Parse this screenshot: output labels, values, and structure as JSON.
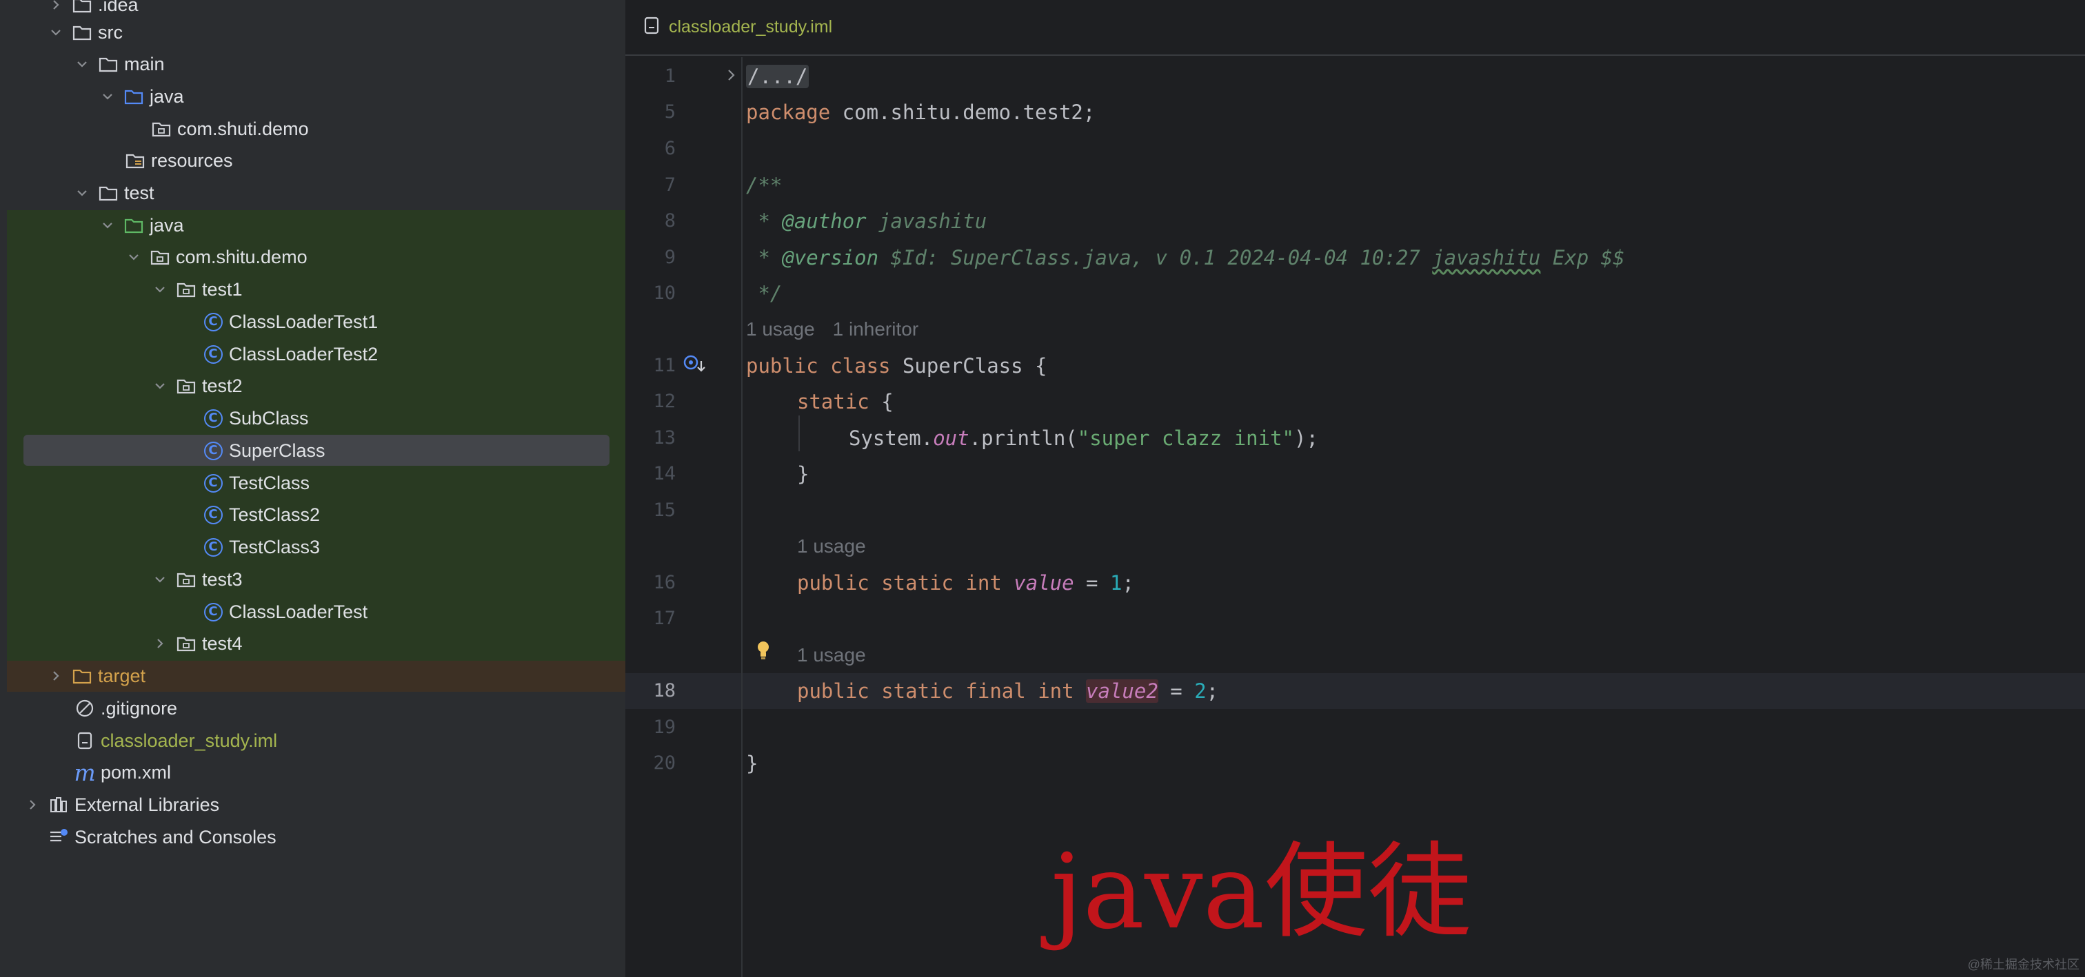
{
  "tree": {
    "items": [
      {
        "label": ".idea",
        "icon": "folder-icon",
        "expanded": false
      },
      {
        "label": "src",
        "icon": "folder-icon",
        "expanded": true
      },
      {
        "label": "main",
        "icon": "folder-icon",
        "expanded": true
      },
      {
        "label": "java",
        "icon": "source-folder-icon",
        "expanded": true
      },
      {
        "label": "com.shuti.demo",
        "icon": "package-icon"
      },
      {
        "label": "resources",
        "icon": "resources-folder-icon"
      },
      {
        "label": "test",
        "icon": "folder-icon",
        "expanded": true
      },
      {
        "label": "java",
        "icon": "test-source-folder-icon",
        "expanded": true
      },
      {
        "label": "com.shitu.demo",
        "icon": "package-icon",
        "expanded": true
      },
      {
        "label": "test1",
        "icon": "package-icon",
        "expanded": true
      },
      {
        "label": "ClassLoaderTest1",
        "icon": "class-icon"
      },
      {
        "label": "ClassLoaderTest2",
        "icon": "class-icon"
      },
      {
        "label": "test2",
        "icon": "package-icon",
        "expanded": true
      },
      {
        "label": "SubClass",
        "icon": "class-icon"
      },
      {
        "label": "SuperClass",
        "icon": "class-icon",
        "selected": true
      },
      {
        "label": "TestClass",
        "icon": "class-icon"
      },
      {
        "label": "TestClass2",
        "icon": "class-icon"
      },
      {
        "label": "TestClass3",
        "icon": "class-icon"
      },
      {
        "label": "test3",
        "icon": "package-icon",
        "expanded": true
      },
      {
        "label": "ClassLoaderTest",
        "icon": "class-icon"
      },
      {
        "label": "test4",
        "icon": "package-icon",
        "expanded": false
      },
      {
        "label": "target",
        "icon": "excluded-folder-icon",
        "expanded": false
      },
      {
        "label": ".gitignore",
        "icon": "ignored-file-icon"
      },
      {
        "label": "classloader_study.iml",
        "icon": "module-file-icon"
      },
      {
        "label": "pom.xml",
        "icon": "maven-icon"
      },
      {
        "label": "External Libraries",
        "icon": "libraries-icon",
        "expanded": false
      },
      {
        "label": "Scratches and Consoles",
        "icon": "scratches-icon"
      }
    ]
  },
  "editor": {
    "tab_label": "classloader_study.iml",
    "current_line": "18",
    "line_numbers": [
      "1",
      "5",
      "6",
      "7",
      "8",
      "9",
      "10",
      "11",
      "12",
      "13",
      "14",
      "15",
      "16",
      "17",
      "18",
      "19",
      "20"
    ],
    "hints": {
      "class_usages": "1 usage",
      "class_inheritors": "1 inheritor",
      "value_usages": "1 usage",
      "value2_usages": "1 usage"
    },
    "code": {
      "fold": "/.../",
      "package_kw": "package",
      "package_name": " com.shitu.demo.test2;",
      "javadoc_open": "/**",
      "author_prefix": " * ",
      "author_tag": "@author",
      "author_value": " javashitu",
      "version_prefix": " * ",
      "version_tag": "@version",
      "version_value_1": " $Id: SuperClass.java, v 0.1 2024-04-04 10:27 ",
      "version_name": "javashitu",
      "version_value_2": " Exp $$",
      "javadoc_close": " */",
      "class_kw": "public class",
      "class_rest": " SuperClass {",
      "static_kw": "static",
      "static_rest": " {",
      "println_prefix": "System.",
      "println_field": "out",
      "println_call": ".println(",
      "println_string": "\"super clazz init\"",
      "println_end": ");",
      "close_static": "}",
      "value_kw": "public static int",
      "value_name": "value",
      "value_eq": " = ",
      "value_num": "1",
      "value_end": ";",
      "value2_kw": "public static final int",
      "value2_name": "value2",
      "value2_eq": " = ",
      "value2_num": "2",
      "value2_end": ";",
      "close_class": "}"
    }
  },
  "watermark": "java使徒",
  "source_mark": "@稀土掘金技术社区",
  "colors": {
    "keyword": "#cf8e6d",
    "comment": "#5f826b",
    "string": "#6aab73",
    "number": "#2aacb8",
    "field": "#c77dbb",
    "class_icon": "#548af7",
    "test_highlight": "#293a22",
    "watermark": "#c2151b"
  }
}
